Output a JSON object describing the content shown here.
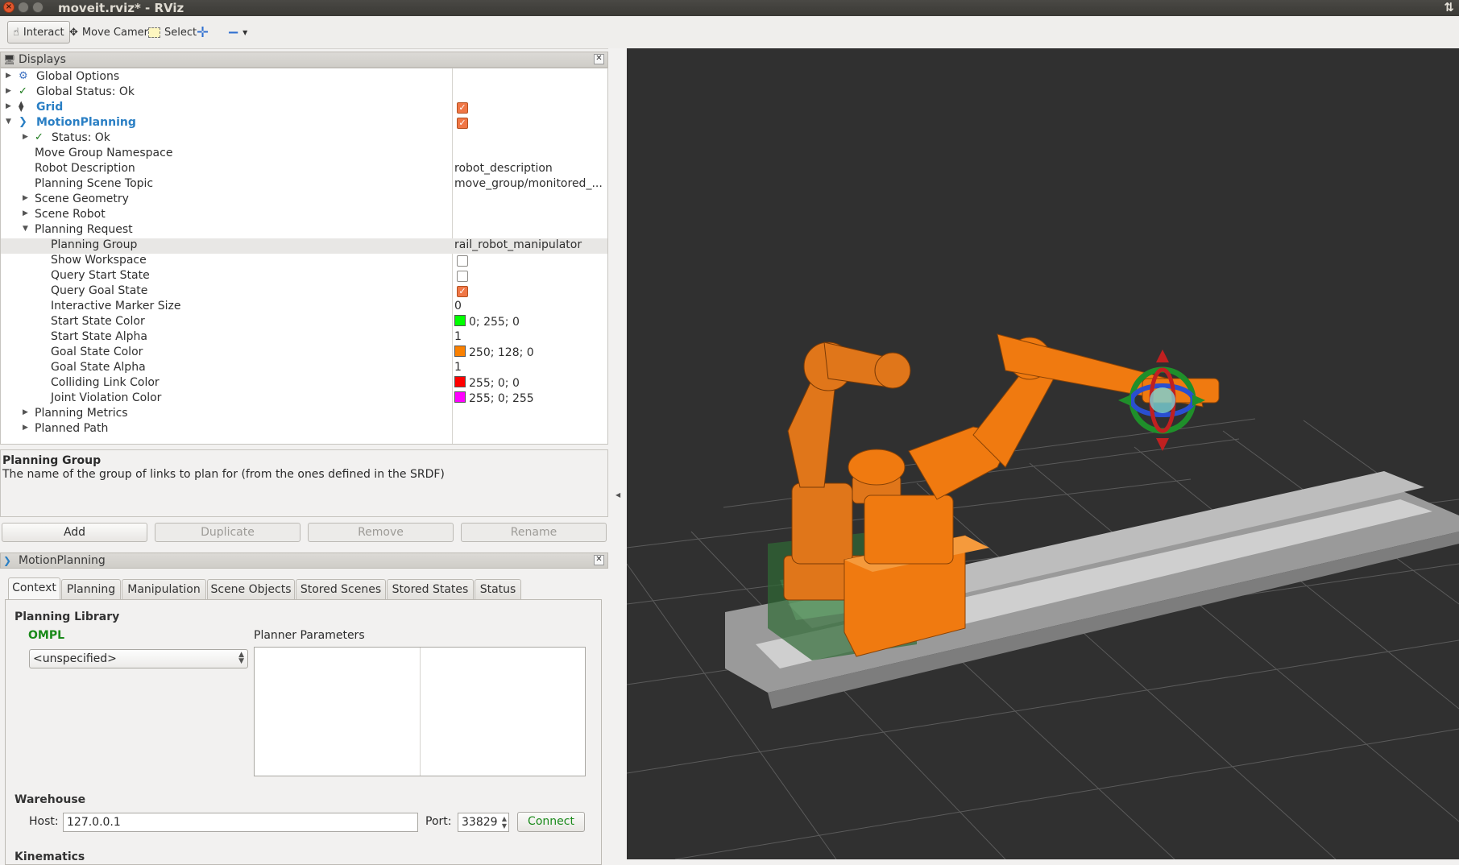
{
  "window": {
    "title": "moveit.rviz* - RViz"
  },
  "toolbar": {
    "interact": "Interact",
    "move_camera": "Move Camera",
    "select": "Select"
  },
  "displays": {
    "title": "Displays",
    "rows": [
      {
        "label": "Global Options"
      },
      {
        "label": "Global Status: Ok"
      },
      {
        "label": "Grid",
        "checked": true
      },
      {
        "label": "MotionPlanning",
        "checked": true
      },
      {
        "label": "Status: Ok"
      },
      {
        "label": "Move Group Namespace",
        "value": ""
      },
      {
        "label": "Robot Description",
        "value": "robot_description"
      },
      {
        "label": "Planning Scene Topic",
        "value": "move_group/monitored_..."
      },
      {
        "label": "Scene Geometry"
      },
      {
        "label": "Scene Robot"
      },
      {
        "label": "Planning Request"
      },
      {
        "label": "Planning Group",
        "value": "rail_robot_manipulator"
      },
      {
        "label": "Show Workspace",
        "checked": false
      },
      {
        "label": "Query Start State",
        "checked": false
      },
      {
        "label": "Query Goal State",
        "checked": true
      },
      {
        "label": "Interactive Marker Size",
        "value": "0"
      },
      {
        "label": "Start State Color",
        "value": "0; 255; 0",
        "color": "#00ff00"
      },
      {
        "label": "Start State Alpha",
        "value": "1"
      },
      {
        "label": "Goal State Color",
        "value": "250; 128; 0",
        "color": "#fa8000"
      },
      {
        "label": "Goal State Alpha",
        "value": "1"
      },
      {
        "label": "Colliding Link Color",
        "value": "255; 0; 0",
        "color": "#ff0000"
      },
      {
        "label": "Joint Violation Color",
        "value": "255; 0; 255",
        "color": "#ff00ff"
      },
      {
        "label": "Planning Metrics"
      },
      {
        "label": "Planned Path"
      }
    ]
  },
  "description": {
    "title": "Planning Group",
    "text": "The name of the group of links to plan for (from the ones defined in the SRDF)"
  },
  "buttons": {
    "add": "Add",
    "duplicate": "Duplicate",
    "remove": "Remove",
    "rename": "Rename"
  },
  "motion_planning": {
    "title": "MotionPlanning",
    "tabs": [
      "Context",
      "Planning",
      "Manipulation",
      "Scene Objects",
      "Stored Scenes",
      "Stored States",
      "Status"
    ],
    "planning_library_label": "Planning Library",
    "library": "OMPL",
    "planner": "<unspecified>",
    "planner_params_label": "Planner Parameters",
    "warehouse_label": "Warehouse",
    "host_label": "Host:",
    "host": "127.0.0.1",
    "port_label": "Port:",
    "port": "33829",
    "connect": "Connect",
    "kinematics_label": "Kinematics"
  },
  "colors": {
    "robot_orange": "#f07a10",
    "start_state_green": "#2f8a3a",
    "viewport_bg": "#303030"
  }
}
